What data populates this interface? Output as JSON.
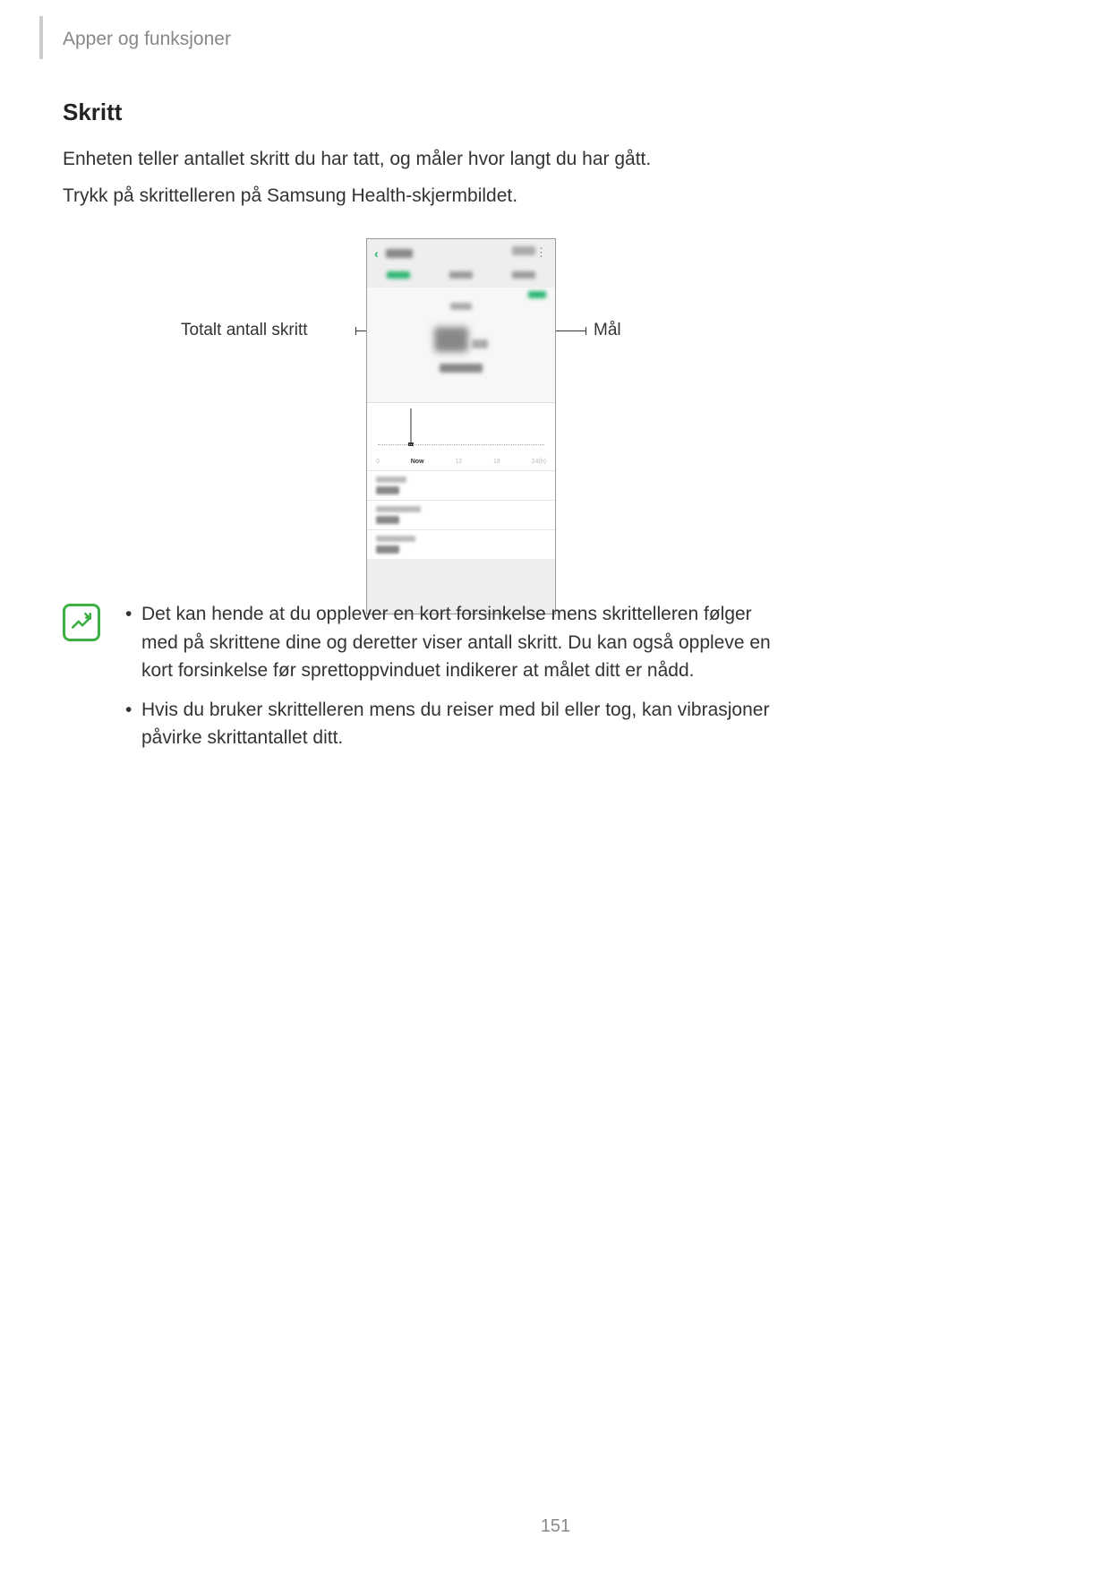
{
  "header": {
    "breadcrumb": "Apper og funksjoner"
  },
  "section": {
    "title": "Skritt"
  },
  "body": {
    "p1": "Enheten teller antallet skritt du har tatt, og måler hvor langt du har gått.",
    "p2": "Trykk på skrittelleren på Samsung Health-skjermbildet."
  },
  "figure": {
    "callout_left": "Totalt antall skritt",
    "callout_right": "Mål",
    "chart_labels": [
      "0",
      "Now",
      "12",
      "18",
      "24(h)"
    ]
  },
  "notes": {
    "item1": "Det kan hende at du opplever en kort forsinkelse mens skrittelleren følger med på skrittene dine og deretter viser antall skritt. Du kan også oppleve en kort forsinkelse før sprettoppvinduet indikerer at målet ditt er nådd.",
    "item2": "Hvis du bruker skrittelleren mens du reiser med bil eller tog, kan vibrasjoner påvirke skrittantallet ditt."
  },
  "page_number": "151"
}
